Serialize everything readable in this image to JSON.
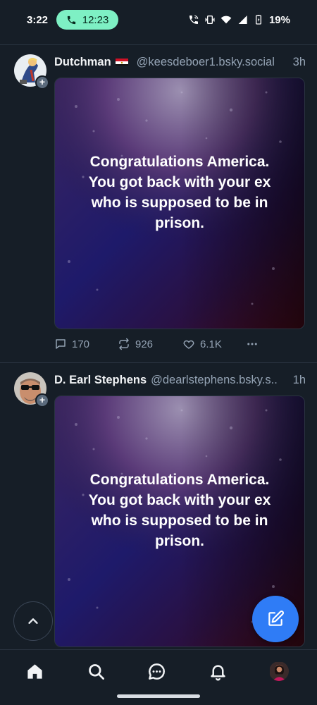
{
  "status_bar": {
    "time": "3:22",
    "call_timer": "12:23",
    "battery": "19%"
  },
  "posts": [
    {
      "display_name": "Dutchman",
      "handle": "@keesdeboer1.bsky.social",
      "time_ago": "3h",
      "image_text": [
        "Congratulations America.",
        "You got back with your ex",
        "who is supposed to be in",
        "prison."
      ],
      "replies": "170",
      "reposts": "926",
      "likes": "6.1K"
    },
    {
      "display_name": "D. Earl Stephens",
      "handle": "@dearlstephens.bsky.s..",
      "time_ago": "1h",
      "image_text": [
        "Congratulations America.",
        "You got back with your ex",
        "who is supposed to be in",
        "prison."
      ]
    }
  ],
  "nav": {
    "items": [
      "home-icon",
      "search-icon",
      "chat-icon",
      "bell-icon",
      "avatar"
    ]
  },
  "colors": {
    "background": "#161e27",
    "accent": "#2f7cf6",
    "call_pill": "#7ef0c4",
    "muted_text": "#94a3b4"
  }
}
